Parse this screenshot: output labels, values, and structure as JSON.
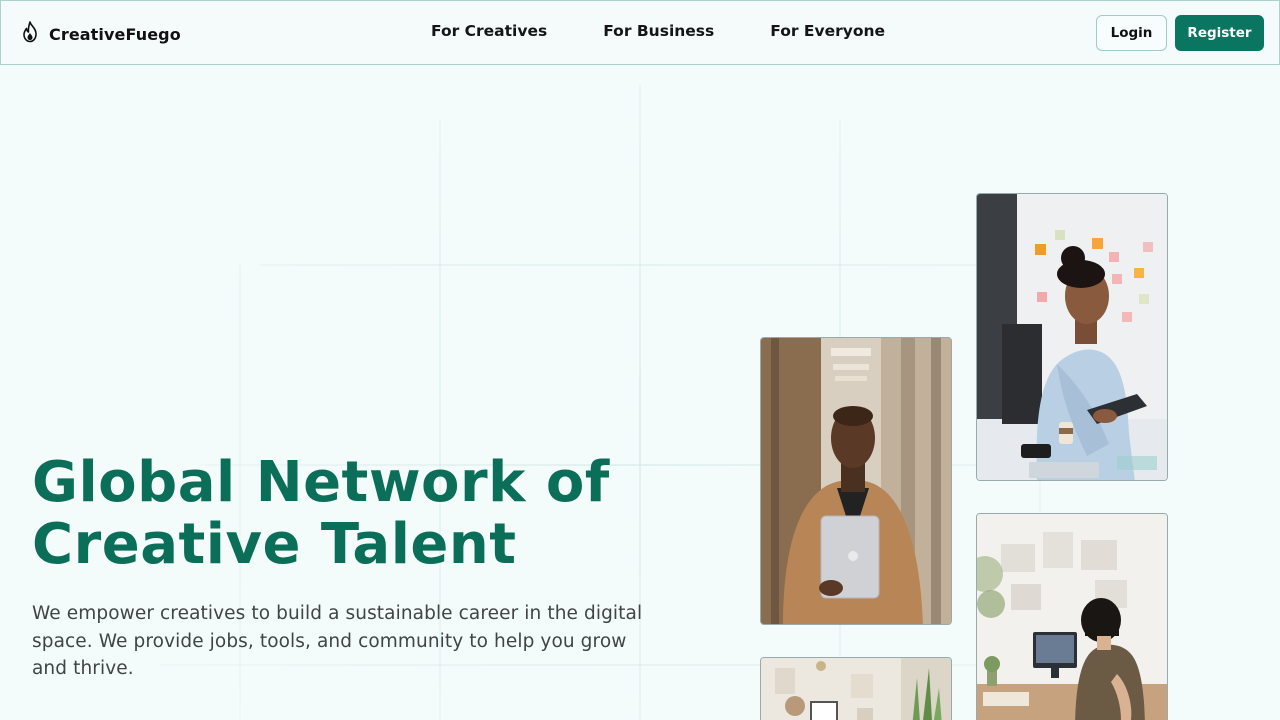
{
  "header": {
    "brand": "CreativeFuego",
    "nav": [
      "For Creatives",
      "For Business",
      "For Everyone"
    ],
    "login_label": "Login",
    "register_label": "Register"
  },
  "hero": {
    "title_line1": "Global Network of",
    "title_line2": "Creative Talent",
    "subtitle_line1": "We empower creatives to build a sustainable career in the digital",
    "subtitle_line2": "space. We provide jobs, tools, and community to help you grow",
    "subtitle_line3": "and thrive."
  },
  "colors": {
    "accent": "#0a7560",
    "title": "#0b6e59",
    "background": "#f4fbfb"
  },
  "icons": {
    "brand": "flame-icon"
  }
}
